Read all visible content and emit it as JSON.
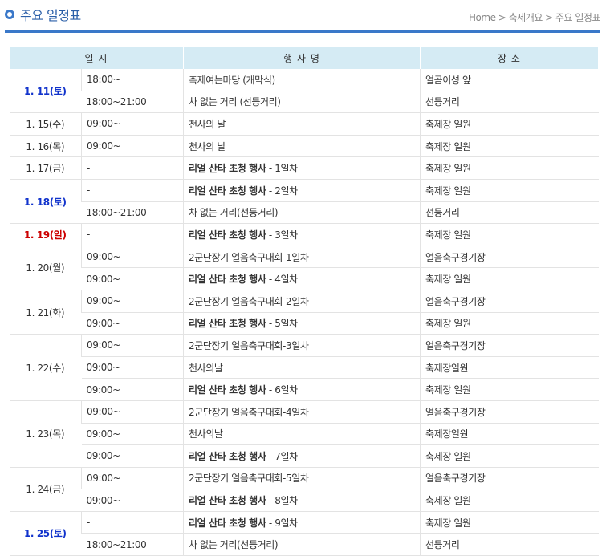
{
  "page": {
    "title": "주요 일정표",
    "breadcrumb": "Home > 축제개요 > 주요 일정표"
  },
  "table": {
    "headers": [
      "일 시",
      "행 사 명",
      "장 소"
    ],
    "groups": [
      {
        "date": "1. 11(토)",
        "style": "blue",
        "rows": [
          {
            "time": "18:00~",
            "event": "축제여는마당 (개막식)",
            "suffix": "",
            "place": "얼곰이성 앞"
          },
          {
            "time": "18:00~21:00",
            "event": "차 없는 거리 (선등거리)",
            "suffix": "",
            "place": "선등거리"
          }
        ]
      },
      {
        "date": "1. 15(수)",
        "style": "normal",
        "rows": [
          {
            "time": "09:00~",
            "event": "천사의 날",
            "suffix": "",
            "place": "축제장 일원"
          }
        ]
      },
      {
        "date": "1. 16(목)",
        "style": "normal",
        "rows": [
          {
            "time": "09:00~",
            "event": "천사의 날",
            "suffix": "",
            "place": "축제장 일원"
          }
        ]
      },
      {
        "date": "1. 17(금)",
        "style": "normal",
        "rows": [
          {
            "time": "-",
            "event": "리얼 산타 초청 행사",
            "suffix": " - 1일차",
            "place": "축제장 일원"
          }
        ]
      },
      {
        "date": "1. 18(토)",
        "style": "blue",
        "rows": [
          {
            "time": "-",
            "event": "리얼 산타 초청 행사",
            "suffix": " - 2일차",
            "place": "축제장 일원"
          },
          {
            "time": "18:00~21:00",
            "event": "차 없는 거리(선등거리)",
            "suffix": "",
            "place": "선등거리"
          }
        ]
      },
      {
        "date": "1. 19(일)",
        "style": "red",
        "rows": [
          {
            "time": "-",
            "event": "리얼 산타 초청 행사",
            "suffix": " - 3일차",
            "place": "축제장 일원"
          }
        ]
      },
      {
        "date": "1. 20(월)",
        "style": "normal",
        "rows": [
          {
            "time": "09:00~",
            "event": "2군단장기 얼음축구대회-1일차",
            "suffix": "",
            "place": "얼음축구경기장"
          },
          {
            "time": "09:00~",
            "event": "리얼 산타 초청 행사",
            "suffix": " - 4일차",
            "place": "축제장 일원"
          }
        ]
      },
      {
        "date": "1. 21(화)",
        "style": "normal",
        "rows": [
          {
            "time": "09:00~",
            "event": "2군단장기 얼음축구대회-2일차",
            "suffix": "",
            "place": "얼음축구경기장"
          },
          {
            "time": "09:00~",
            "event": "리얼 산타 초청 행사",
            "suffix": " - 5일차",
            "place": "축제장 일원"
          }
        ]
      },
      {
        "date": "1. 22(수)",
        "style": "normal",
        "rows": [
          {
            "time": "09:00~",
            "event": "2군단장기 얼음축구대회-3일차",
            "suffix": "",
            "place": "얼음축구경기장"
          },
          {
            "time": "09:00~",
            "event": "천사의날",
            "suffix": "",
            "place": "축제장일원"
          },
          {
            "time": "09:00~",
            "event": "리얼 산타 초청 행사",
            "suffix": " - 6일차",
            "place": "축제장 일원"
          }
        ]
      },
      {
        "date": "1. 23(목)",
        "style": "normal",
        "rows": [
          {
            "time": "09:00~",
            "event": "2군단장기 얼음축구대회-4일차",
            "suffix": "",
            "place": "얼음축구경기장"
          },
          {
            "time": "09:00~",
            "event": "천사의날",
            "suffix": "",
            "place": "축제장일원"
          },
          {
            "time": "09:00~",
            "event": "리얼 산타 초청 행사",
            "suffix": " - 7일차",
            "place": "축제장 일원"
          }
        ]
      },
      {
        "date": "1. 24(금)",
        "style": "normal",
        "rows": [
          {
            "time": "09:00~",
            "event": "2군단장기 얼음축구대회-5일차",
            "suffix": "",
            "place": "얼음축구경기장"
          },
          {
            "time": "09:00~",
            "event": "리얼 산타 초청 행사",
            "suffix": " - 8일차",
            "place": "축제장 일원"
          }
        ]
      },
      {
        "date": "1. 25(토)",
        "style": "blue",
        "rows": [
          {
            "time": "-",
            "event": "리얼 산타 초청 행사",
            "suffix": " - 9일차",
            "place": "축제장 일원"
          },
          {
            "time": "18:00~21:00",
            "event": "차 없는 거리(선등거리)",
            "suffix": "",
            "place": "선등거리"
          }
        ]
      }
    ]
  },
  "colors": {
    "accent": "#3a78c9",
    "header_bg": "#d5ebf4",
    "saturday": "#1133cc",
    "sunday": "#cc0000"
  }
}
